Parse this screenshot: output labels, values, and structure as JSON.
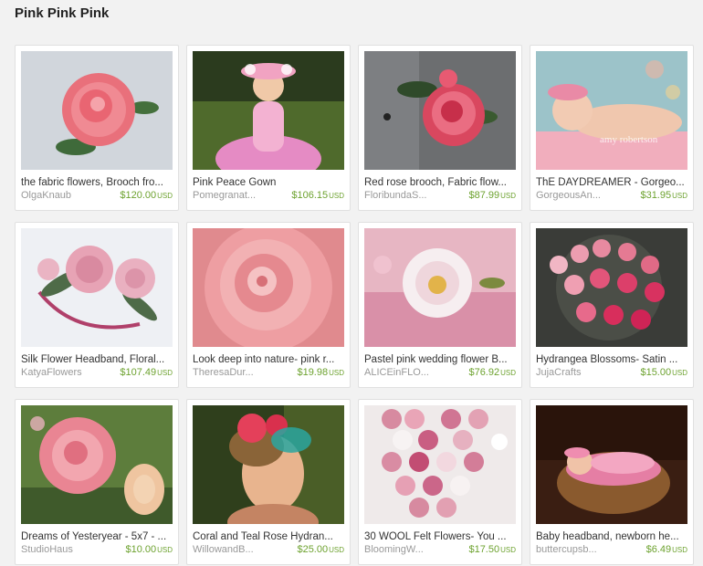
{
  "page": {
    "title": "Pink Pink Pink"
  },
  "items": [
    {
      "title": "the fabric flowers, Brooch fro...",
      "shop": "OlgaKnaub",
      "price": "$120.00",
      "currency": "USD",
      "image": "pink-rose-brooch-photo"
    },
    {
      "title": "Pink Peace Gown",
      "shop": "Pomegranat...",
      "price": "$106.15",
      "currency": "USD",
      "image": "girl-in-pink-gown-photo"
    },
    {
      "title": "Red rose brooch, Fabric flow...",
      "shop": "FloribundaS...",
      "price": "$87.99",
      "currency": "USD",
      "image": "red-rose-brooch-photo"
    },
    {
      "title": "ThE DAYDREAMER - Gorgeo...",
      "shop": "GorgeousAn...",
      "price": "$31.95",
      "currency": "USD",
      "image": "sleeping-baby-photo"
    },
    {
      "title": "Silk Flower Headband, Floral...",
      "shop": "KatyaFlowers",
      "price": "$107.49",
      "currency": "USD",
      "image": "silk-flower-headband-photo"
    },
    {
      "title": "Look deep into nature- pink r...",
      "shop": "TheresaDur...",
      "price": "$19.98",
      "currency": "USD",
      "image": "pink-rose-closeup-photo"
    },
    {
      "title": "Pastel pink wedding flower B...",
      "shop": "ALICEinFLO...",
      "price": "$76.92",
      "currency": "USD",
      "image": "pastel-wedding-flower-photo"
    },
    {
      "title": "Hydrangea Blossoms- Satin ...",
      "shop": "JujaCrafts",
      "price": "$15.00",
      "currency": "USD",
      "image": "hydrangea-petals-photo"
    },
    {
      "title": "Dreams of Yesteryear - 5x7 - ...",
      "shop": "StudioHaus",
      "price": "$10.00",
      "currency": "USD",
      "image": "roses-print-photo"
    },
    {
      "title": "Coral and Teal Rose Hydran...",
      "shop": "WillowandB...",
      "price": "$25.00",
      "currency": "USD",
      "image": "girl-with-fascinator-photo"
    },
    {
      "title": "30 WOOL Felt Flowers- You ...",
      "shop": "BloomingW...",
      "price": "$17.50",
      "currency": "USD",
      "image": "felt-flowers-photo"
    },
    {
      "title": "Baby headband, newborn he...",
      "shop": "buttercupsb...",
      "price": "$6.49",
      "currency": "USD",
      "image": "newborn-in-basket-photo"
    }
  ],
  "colors": {
    "price": "#6da22f",
    "shop": "#999999"
  }
}
